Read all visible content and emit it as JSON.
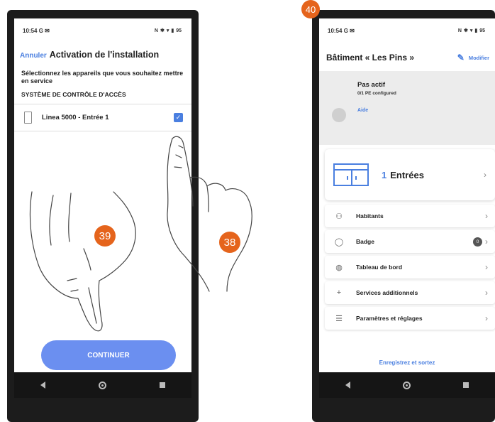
{
  "left_screen": {
    "status_time": "10:54",
    "status_left_icons": "G ✉",
    "status_right_icons": [
      "N",
      "✱",
      "▾",
      "▮",
      "95"
    ],
    "header": {
      "cancel_label": "Annuler",
      "title": "Activation de l'installation"
    },
    "instruction": "Sélectionnez les appareils que vous souhaitez mettre en service",
    "section_title": "SYSTÈME DE CONTRÔLE D'ACCÈS",
    "devices": [
      {
        "label": "Linea 5000 - Entrée 1",
        "checked": true,
        "icon": "intercom-device-icon"
      }
    ],
    "continue_label": "CONTINUER"
  },
  "right_screen": {
    "status_time": "10:54",
    "status_left_icons": "G ✉",
    "status_right_icons": [
      "N",
      "✱",
      "▾",
      "▮",
      "95"
    ],
    "header": {
      "title": "Bâtiment « Les Pins »",
      "modify_label": "Modifier"
    },
    "status_card": {
      "title": "Pas actif",
      "subtitle": "0/1 PE configured",
      "help_label": "Aide"
    },
    "entrees": {
      "count": "1",
      "label": "Entrées"
    },
    "menu": [
      {
        "icon": "residents-icon",
        "glyph": "⚇",
        "label": "Habitants"
      },
      {
        "icon": "badge-icon",
        "glyph": "◯",
        "label": "Badge",
        "count": "0"
      },
      {
        "icon": "dashboard-icon",
        "glyph": "◍",
        "label": "Tableau de bord"
      },
      {
        "icon": "plus-icon",
        "glyph": "+",
        "label": "Services additionnels"
      },
      {
        "icon": "sliders-icon",
        "glyph": "☰",
        "label": "Paramètres et réglages"
      }
    ],
    "save_label": "Enregistrez et sortez"
  },
  "steps": {
    "step_38": "38",
    "step_39": "39",
    "step_40": "40"
  },
  "colors": {
    "accent": "#4a7fe0",
    "button": "#6b8ff0",
    "step": "#e5641c",
    "frame": "#1c1c1c"
  }
}
